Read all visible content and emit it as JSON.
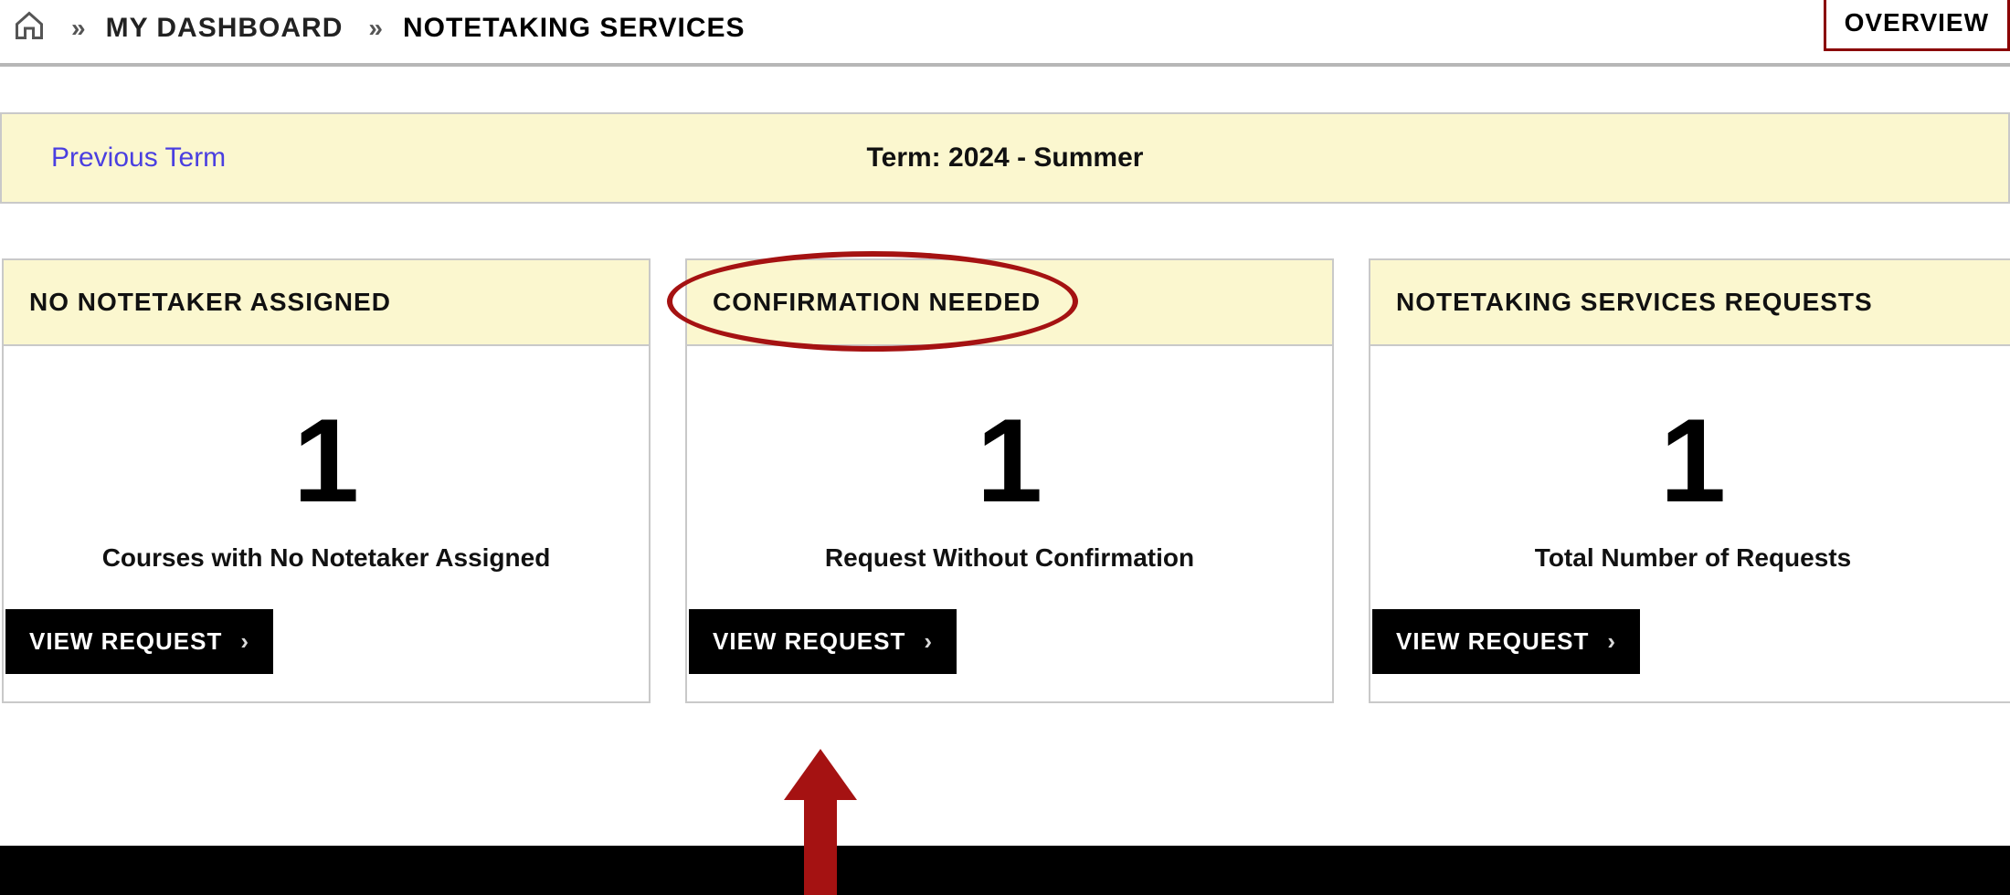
{
  "breadcrumb": {
    "dashboard": "MY DASHBOARD",
    "current": "NOTETAKING SERVICES"
  },
  "overview_button": "OVERVIEW",
  "term_bar": {
    "prev": "Previous Term",
    "term": "Term: 2024 - Summer"
  },
  "cards": [
    {
      "title": "NO NOTETAKER ASSIGNED",
      "count": "1",
      "subtitle": "Courses with No Notetaker Assigned",
      "button": "VIEW REQUEST"
    },
    {
      "title": "CONFIRMATION NEEDED",
      "count": "1",
      "subtitle": "Request Without Confirmation",
      "button": "VIEW REQUEST"
    },
    {
      "title": "NOTETAKING SERVICES REQUESTS",
      "count": "1",
      "subtitle": "Total Number of Requests",
      "button": "VIEW REQUEST"
    }
  ]
}
